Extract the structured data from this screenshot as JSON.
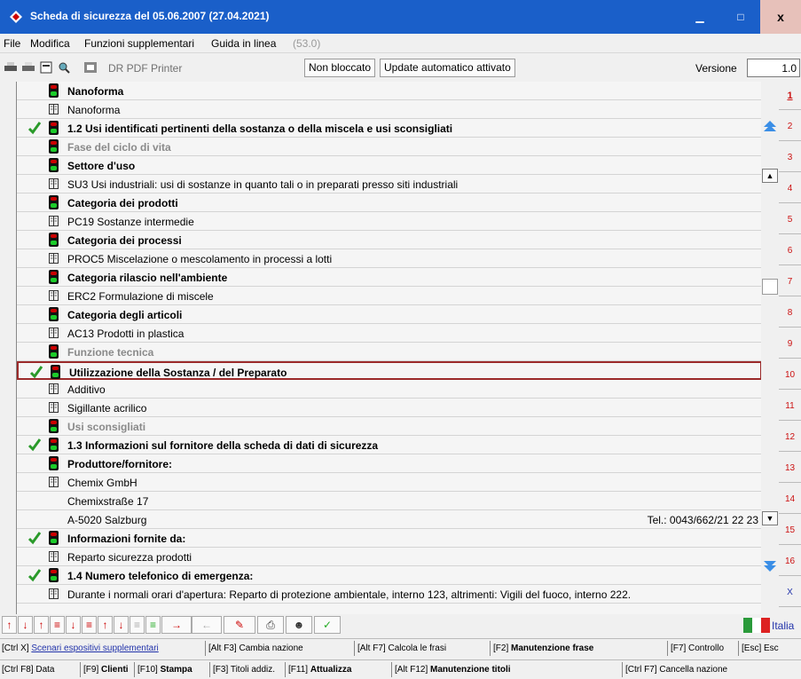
{
  "window": {
    "title": "Scheda di sicurezza del 05.06.2007 (27.04.2021)",
    "minimize": "▁",
    "maximize": "□",
    "close": "x"
  },
  "menu": {
    "items": [
      "File",
      "Modifica",
      "Funzioni supplementari",
      "Guida in linea"
    ],
    "extra": "(53.0)"
  },
  "toolbar": {
    "pdf_printer": "DR PDF Printer",
    "lock_button": "Non bloccato",
    "auto_update_button": "Update automatico attivato",
    "version_label": "Versione",
    "version_value": "1.0"
  },
  "rows": [
    {
      "text": "Nanoforma",
      "icon": "traffic-light",
      "style": "bold",
      "check": false
    },
    {
      "text": "Nanoforma",
      "icon": "book",
      "style": "normal",
      "check": false
    },
    {
      "text": "1.2 Usi identificati pertinenti della sostanza o della miscela e usi sconsigliati",
      "icon": "traffic-light",
      "style": "bold",
      "check": true
    },
    {
      "text": "Fase del ciclo di vita",
      "icon": "traffic-light",
      "style": "grey",
      "check": false
    },
    {
      "text": "Settore d'uso",
      "icon": "traffic-light",
      "style": "bold",
      "check": false
    },
    {
      "text": "SU3  Usi industriali: usi di sostanze in quanto tali o in preparati presso siti industriali",
      "icon": "book",
      "style": "normal",
      "check": false
    },
    {
      "text": "Categoria dei prodotti",
      "icon": "traffic-light",
      "style": "bold",
      "check": false
    },
    {
      "text": "PC19  Sostanze intermedie",
      "icon": "book",
      "style": "normal",
      "check": false
    },
    {
      "text": "Categoria dei processi",
      "icon": "traffic-light",
      "style": "bold",
      "check": false
    },
    {
      "text": "PROC5  Miscelazione o mescolamento in processi a lotti",
      "icon": "book",
      "style": "normal",
      "check": false
    },
    {
      "text": "Categoria rilascio nell'ambiente",
      "icon": "traffic-light",
      "style": "bold",
      "check": false
    },
    {
      "text": "ERC2  Formulazione di miscele",
      "icon": "book",
      "style": "normal",
      "check": false
    },
    {
      "text": "Categoria degli articoli",
      "icon": "traffic-light",
      "style": "bold",
      "check": false
    },
    {
      "text": "AC13  Prodotti in plastica",
      "icon": "book",
      "style": "normal",
      "check": false
    },
    {
      "text": "Funzione tecnica",
      "icon": "traffic-light",
      "style": "grey",
      "check": false
    },
    {
      "text": "Utilizzazione  della Sostanza / del Preparato",
      "icon": "traffic-light",
      "style": "bold",
      "check": true,
      "selected": true
    },
    {
      "text": "Additivo",
      "icon": "book",
      "style": "normal",
      "check": false
    },
    {
      "text": "Sigillante acrilico",
      "icon": "book",
      "style": "normal",
      "check": false
    },
    {
      "text": "Usi sconsigliati",
      "icon": "traffic-light",
      "style": "grey",
      "check": false
    },
    {
      "text": "1.3 Informazioni sul fornitore della scheda di dati di sicurezza",
      "icon": "traffic-light",
      "style": "bold",
      "check": true
    },
    {
      "text": "Produttore/fornitore:",
      "icon": "traffic-light",
      "style": "bold",
      "check": false
    },
    {
      "text": "Chemix GmbH",
      "icon": "book",
      "style": "normal",
      "check": false
    },
    {
      "text": "Chemixstraße 17",
      "icon": "none",
      "style": "normal",
      "check": false
    },
    {
      "text": "A-5020 Salzburg",
      "icon": "none",
      "style": "normal",
      "check": false,
      "phone": "Tel.: 0043/662/21 22 23"
    },
    {
      "text": "Informazioni fornite da:",
      "icon": "traffic-light",
      "style": "bold",
      "check": true
    },
    {
      "text": "Reparto sicurezza prodotti",
      "icon": "book",
      "style": "normal",
      "check": false
    },
    {
      "text": "1.4 Numero telefonico di emergenza:",
      "icon": "traffic-light",
      "style": "bold",
      "check": true
    },
    {
      "text": "Durante i normali orari d'apertura: Reparto di protezione ambientale, interno 123, altrimenti: Vigili del fuoco, interno 222.",
      "icon": "book",
      "style": "normal",
      "check": false
    }
  ],
  "page_tabs": [
    "1",
    "2",
    "3",
    "4",
    "5",
    "6",
    "7",
    "8",
    "9",
    "10",
    "11",
    "12",
    "13",
    "14",
    "15",
    "16",
    "X"
  ],
  "language": {
    "label": "Italia"
  },
  "shortcuts_row1": [
    {
      "key": "[Ctrl X]",
      "label": "Scenari espositivi supplementari",
      "link": true
    },
    {
      "key": "[Alt F3]",
      "label": "Cambia nazione"
    },
    {
      "key": "[Alt F7]",
      "label": "Calcola le frasi"
    },
    {
      "key": "[F2]",
      "label": "Manutenzione frase",
      "bold": true
    },
    {
      "key": "[F7]",
      "label": "Controllo"
    },
    {
      "key": "[Esc]",
      "label": "Esc"
    }
  ],
  "shortcuts_row2": [
    {
      "key": "[Ctrl F8]",
      "label": "Data"
    },
    {
      "key": "[F9]",
      "label": "Clienti",
      "bold": true
    },
    {
      "key": "[F10]",
      "label": "Stampa",
      "bold": true
    },
    {
      "key": "[F3]",
      "label": "Titoli addiz."
    },
    {
      "key": "[F11]",
      "label": "Attualizza",
      "bold": true
    },
    {
      "key": "[Alt F12]",
      "label": "Manutenzione titoli",
      "bold": true
    },
    {
      "key": "[Ctrl F7]",
      "label": "Cancella nazione"
    }
  ],
  "colors": {
    "titlebar": "#1a5fc9",
    "accent_red": "#cc1111",
    "link_blue": "#2233aa"
  }
}
